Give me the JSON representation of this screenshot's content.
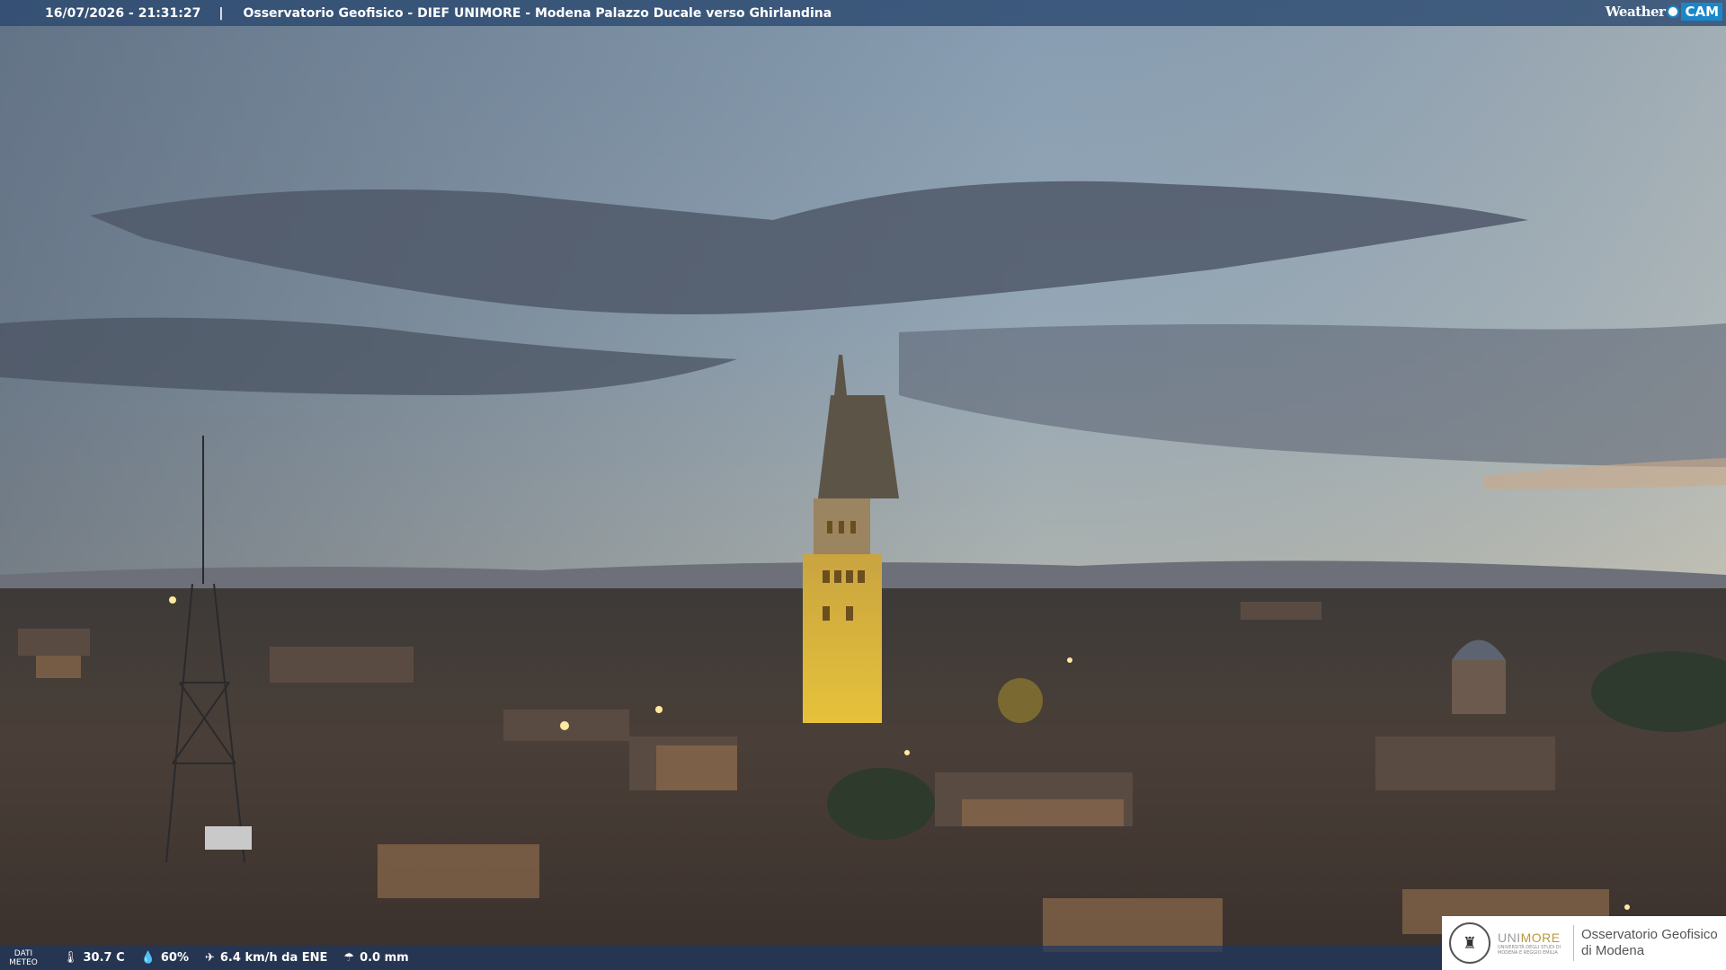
{
  "header": {
    "datetime": "16/07/2026 - 21:31:27",
    "separator": "|",
    "title": "Osservatorio Geofisico - DIEF UNIMORE - Modena Palazzo Ducale verso Ghirlandina",
    "logo_weather": "Weather",
    "logo_cam": "CAM"
  },
  "weather": {
    "label_line1": "DATI",
    "label_line2": "METEO",
    "temperature": "30.7 C",
    "humidity": "60%",
    "wind": "6.4 km/h da ENE",
    "rain": "0.0 mm"
  },
  "brand": {
    "uni_a": "UNI",
    "uni_b": "MORE",
    "uni_sub1": "UNIVERSITÀ DEGLI STUDI DI",
    "uni_sub2": "MODENA E REGGIO EMILIA",
    "obs_line1": "Osservatorio Geofisico",
    "obs_line2": "di Modena"
  },
  "icons": {
    "thermometer": "thermometer-icon",
    "humidity": "droplet-icon",
    "wind": "wind-icon",
    "rain": "rain-icon"
  },
  "colors": {
    "bar": "#28466e",
    "cam_blue": "#1b86c8",
    "tower_light": "#e6c23a"
  }
}
